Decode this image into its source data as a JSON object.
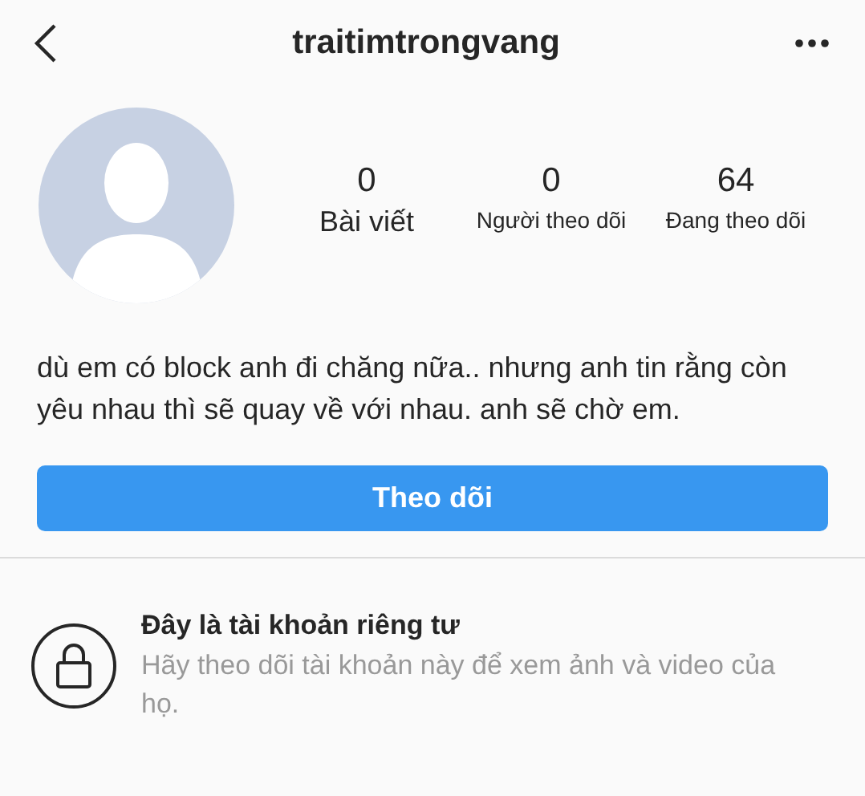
{
  "header": {
    "title": "traitimtrongvang"
  },
  "stats": [
    {
      "value": "0",
      "label": "Bài viết"
    },
    {
      "value": "0",
      "label": "Người theo dõi"
    },
    {
      "value": "64",
      "label": "Đang theo dõi"
    }
  ],
  "bio": "dù em có block anh đi chăng nữa.. nhưng anh tin rằng còn yêu nhau thì sẽ quay về với nhau. anh sẽ chờ em.",
  "follow_button": "Theo dõi",
  "private_notice": {
    "title": "Đây là tài khoản riêng tư",
    "message": "Hãy theo dõi tài khoản này để xem ảnh và video của họ."
  }
}
